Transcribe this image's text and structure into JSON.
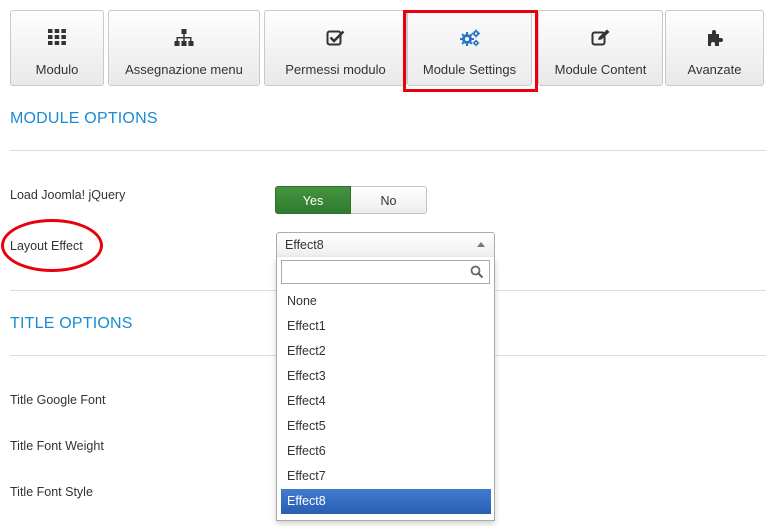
{
  "tabs": [
    {
      "label": "Modulo",
      "icon": "grid-icon"
    },
    {
      "label": "Assegnazione menu",
      "icon": "sitemap-icon"
    },
    {
      "label": "Permessi modulo",
      "icon": "checkbox-icon"
    },
    {
      "label": "Module Settings",
      "icon": "gears-icon"
    },
    {
      "label": "Module Content",
      "icon": "edit-icon"
    },
    {
      "label": "Avanzate",
      "icon": "puzzle-icon"
    }
  ],
  "active_tab": "Module Settings",
  "sections": {
    "module_options": "MODULE OPTIONS",
    "title_options": "TITLE OPTIONS"
  },
  "fields": {
    "load_jquery": {
      "label": "Load Joomla! jQuery",
      "yes": "Yes",
      "no": "No",
      "value": "Yes"
    },
    "layout_effect": {
      "label": "Layout Effect",
      "value": "Effect8",
      "search_placeholder": ""
    },
    "title_google_font": {
      "label": "Title Google Font"
    },
    "title_font_weight": {
      "label": "Title Font Weight"
    },
    "title_font_style": {
      "label": "Title Font Style"
    }
  },
  "dropdown_options": [
    "None",
    "Effect1",
    "Effect2",
    "Effect3",
    "Effect4",
    "Effect5",
    "Effect6",
    "Effect7",
    "Effect8"
  ],
  "colors": {
    "accent": "#1a8bd3",
    "highlight": "#e8000b",
    "toggle_yes": "#2f7b2f",
    "selected_option": "#2a5fb3"
  }
}
